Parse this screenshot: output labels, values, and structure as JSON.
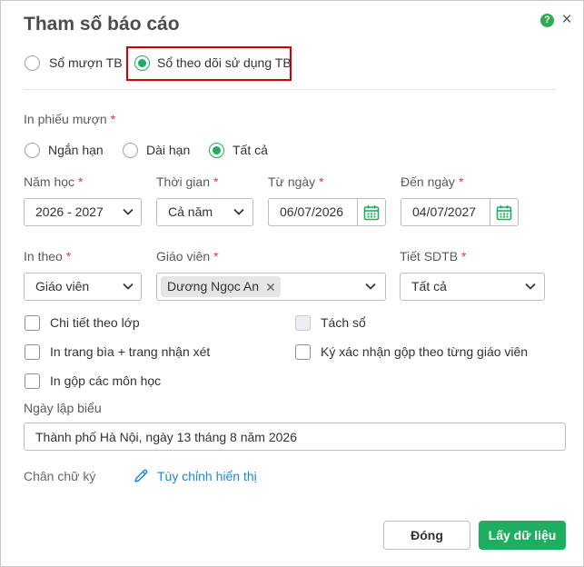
{
  "dialog": {
    "title": "Tham số báo cáo",
    "help_icon": "help-icon",
    "close_icon": "close-icon"
  },
  "required_mark": "*",
  "report_type": {
    "options": [
      {
        "label": "Sổ mượn TB",
        "checked": false
      },
      {
        "label": "Sổ theo dõi sử dụng TB",
        "checked": true,
        "highlighted": true
      }
    ]
  },
  "loan_slip": {
    "label": "In phiếu mượn",
    "options": [
      {
        "label": "Ngắn hạn",
        "checked": false
      },
      {
        "label": "Dài hạn",
        "checked": false
      },
      {
        "label": "Tất cả",
        "checked": true
      }
    ]
  },
  "filters": {
    "school_year": {
      "label": "Năm học",
      "value": "2026 - 2027"
    },
    "period": {
      "label": "Thời gian",
      "value": "Cả năm"
    },
    "from_date": {
      "label": "Từ ngày",
      "value": "06/07/2026",
      "icon": "calendar-icon"
    },
    "to_date": {
      "label": "Đến ngày",
      "value": "04/07/2027",
      "icon": "calendar-icon"
    },
    "print_by": {
      "label": "In theo",
      "value": "Giáo viên"
    },
    "teacher": {
      "label": "Giáo viên",
      "selected": [
        "Dương Ngọc An"
      ],
      "remove_icon": "close-icon"
    },
    "lesson_count": {
      "label": "Tiết SDTB",
      "value": "Tất cả"
    }
  },
  "options": [
    {
      "label": "Chi tiết theo lớp",
      "checked": false,
      "disabled": false
    },
    {
      "label": "Tách sổ",
      "checked": false,
      "disabled": true
    },
    {
      "label": "In trang bìa + trang nhận xét",
      "checked": false,
      "disabled": false
    },
    {
      "label": "Ký xác nhận gộp theo từng giáo viên",
      "checked": false,
      "disabled": false
    },
    {
      "label": "In gộp các môn học",
      "checked": false,
      "disabled": false
    }
  ],
  "report_date": {
    "label": "Ngày lập biểu",
    "value": "Thành phố Hà Nội, ngày 13 tháng 8 năm 2026"
  },
  "signature": {
    "label": "Chân chữ ký",
    "link": "Tùy chỉnh hiển thị",
    "icon": "pencil-icon"
  },
  "footer": {
    "close_label": "Đóng",
    "submit_label": "Lấy dữ liệu"
  },
  "colors": {
    "accent": "#1eae5f",
    "required": "#e53935",
    "link": "#1a8ad4",
    "highlight_border": "#d40000"
  }
}
